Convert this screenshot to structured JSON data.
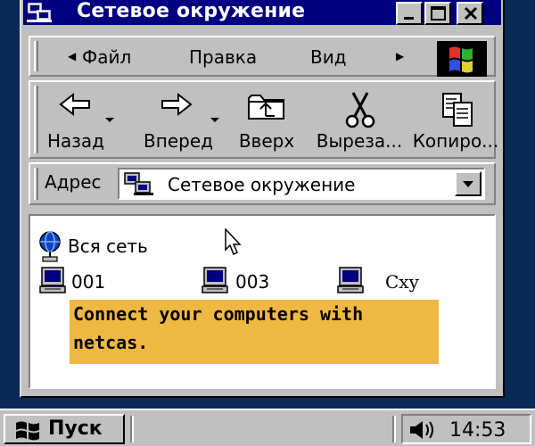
{
  "window": {
    "title": "Сетевое окружение",
    "caption_buttons": [
      "minimize-icon",
      "maximize-icon",
      "close-icon"
    ]
  },
  "menu": {
    "items": [
      {
        "label": "Файл"
      },
      {
        "label": "Правка"
      },
      {
        "label": "Вид"
      }
    ]
  },
  "toolbar": {
    "buttons": [
      {
        "label": "Назад",
        "icon": "back-arrow-icon"
      },
      {
        "label": "Вперед",
        "icon": "forward-arrow-icon"
      },
      {
        "label": "Вверх",
        "icon": "up-folder-icon"
      },
      {
        "label": "Выреза...",
        "icon": "scissors-icon"
      },
      {
        "label": "Копиро...",
        "icon": "copy-icon"
      }
    ]
  },
  "address": {
    "label": "Адрес",
    "value": "Сетевое окружение"
  },
  "content": {
    "items": [
      {
        "label": "Вся сеть",
        "icon": "globe-network-icon"
      },
      {
        "label": "001",
        "icon": "computer-icon"
      },
      {
        "label": "003",
        "icon": "computer-icon"
      },
      {
        "label": "Cxy",
        "icon": "computer-icon"
      }
    ],
    "tooltip": {
      "line1": "Connect your computers with",
      "line2": "netcas."
    }
  },
  "taskbar": {
    "start_label": "Пуск",
    "clock": "14:53"
  },
  "colors": {
    "title_bar": "#000080",
    "face": "#c0c0c0",
    "tooltip_bg": "#efb842",
    "desktop": "#0a2a55"
  }
}
